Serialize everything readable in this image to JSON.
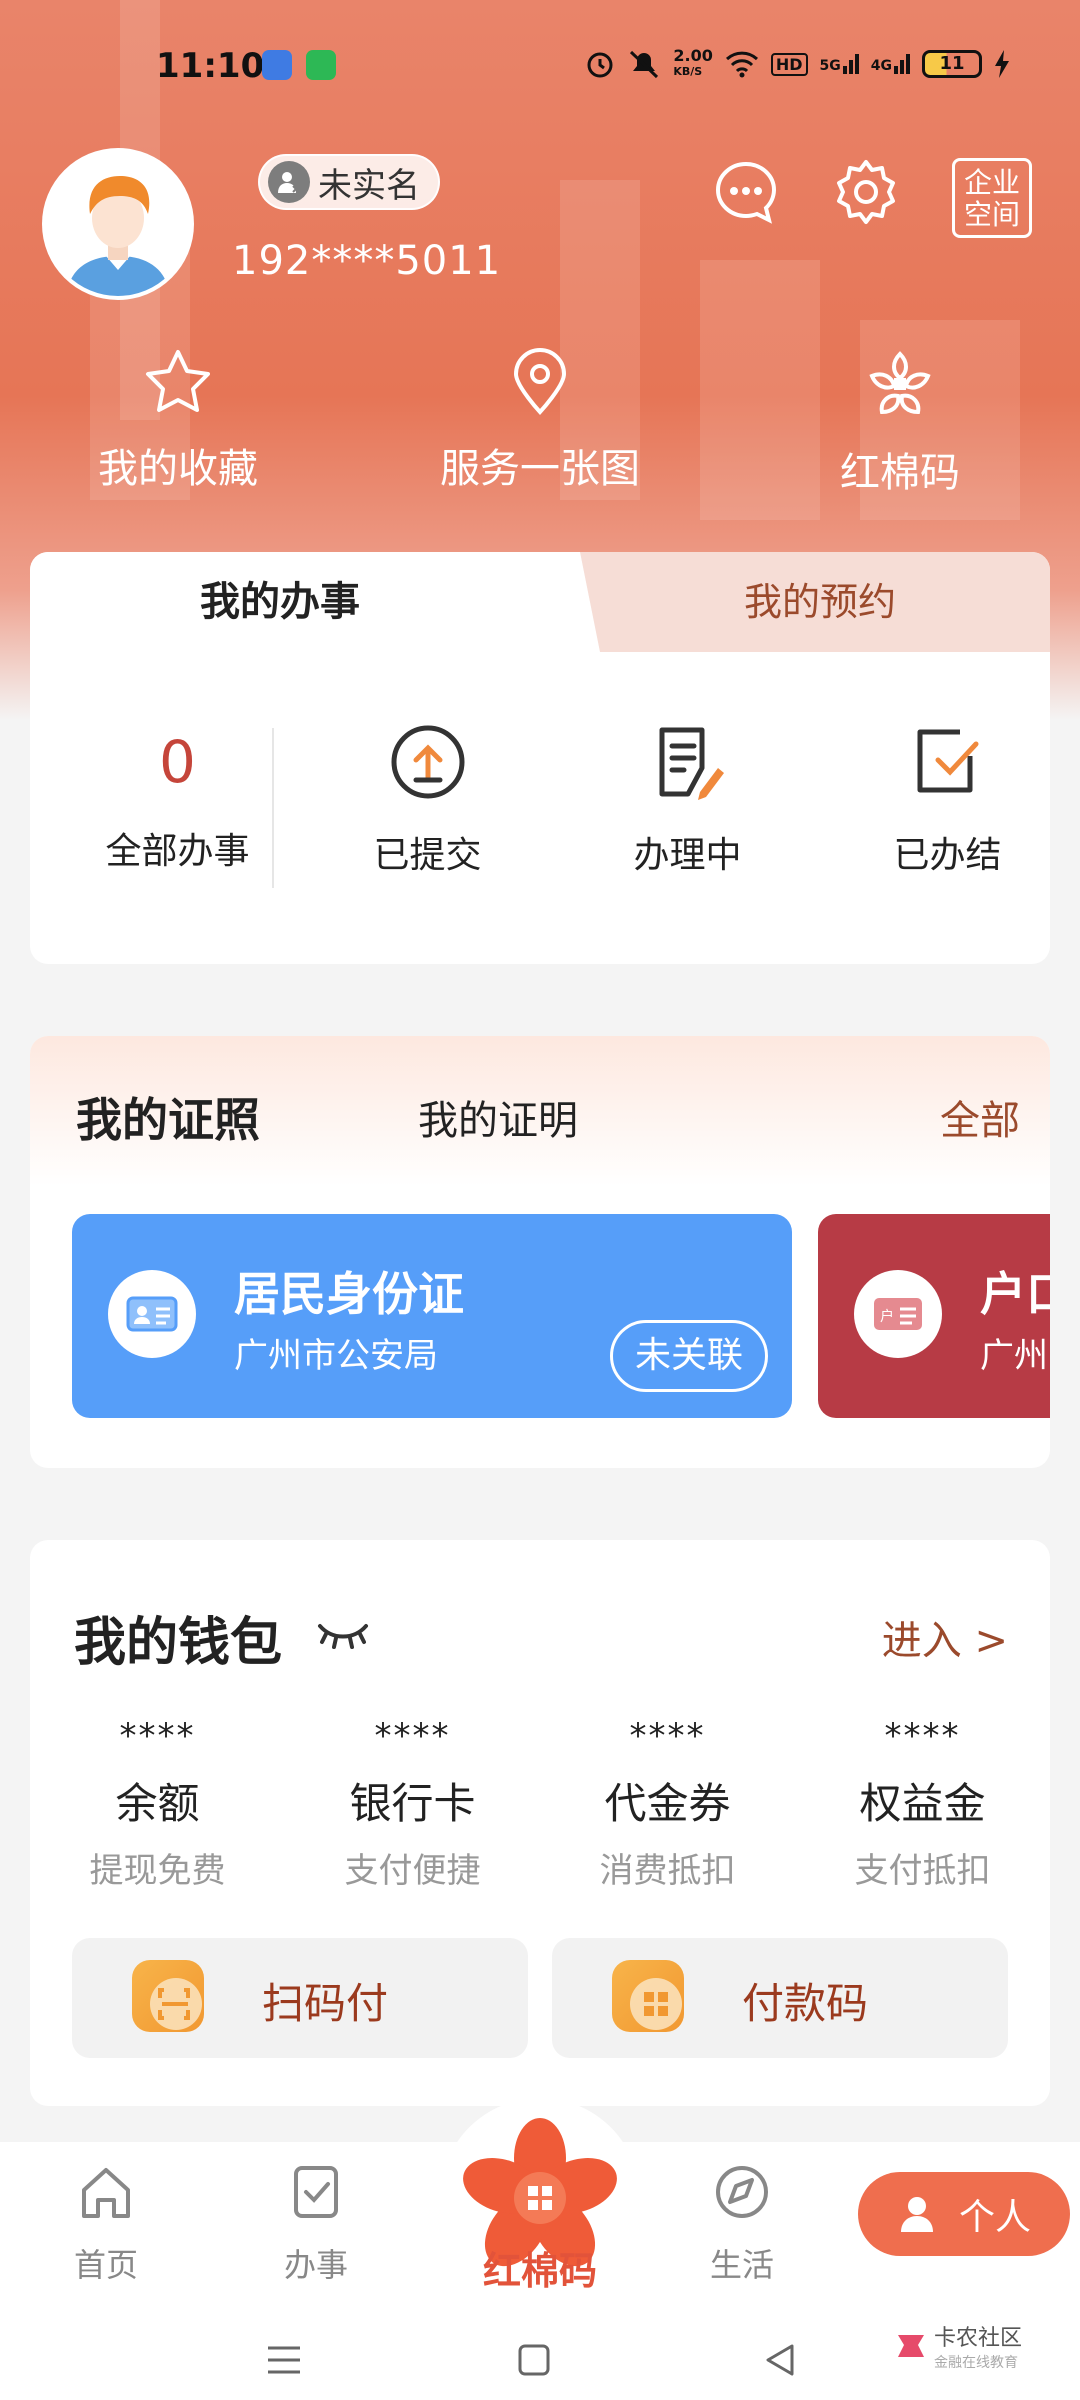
{
  "status_bar": {
    "time": "11:10",
    "net_speed_value": "2.00",
    "net_speed_unit": "KB/S",
    "signal1": "5G",
    "signal2": "4G",
    "battery": "11",
    "hd_label": "HD"
  },
  "profile": {
    "real_name_status": "未实名",
    "phone": "192****5011",
    "enterprise_label_line1": "企业",
    "enterprise_label_line2": "空间"
  },
  "quick_actions": [
    {
      "label": "我的收藏",
      "icon": "star-icon"
    },
    {
      "label": "服务一张图",
      "icon": "location-pin-icon"
    },
    {
      "label": "红棉码",
      "icon": "kapok-flower-icon"
    }
  ],
  "affairs": {
    "tab_active": "我的办事",
    "tab_inactive": "我的预约",
    "total_count": "0",
    "items": [
      {
        "label": "全部办事"
      },
      {
        "label": "已提交",
        "icon": "upload-circle-icon"
      },
      {
        "label": "办理中",
        "icon": "document-edit-icon"
      },
      {
        "label": "已办结",
        "icon": "checkbox-done-icon"
      }
    ]
  },
  "certificates": {
    "title": "我的证照",
    "tab2": "我的证明",
    "all_link": "全部",
    "cards": [
      {
        "name": "居民身份证",
        "org": "广州市公安局",
        "status": "未关联",
        "color": "#569ef9"
      },
      {
        "name": "户口",
        "org": "广州",
        "color": "#b73b45"
      }
    ],
    "second_card_icon_text": "户"
  },
  "wallet": {
    "title": "我的钱包",
    "enter_link": "进入 >",
    "items": [
      {
        "stars": "****",
        "name": "余额",
        "sub": "提现免费"
      },
      {
        "stars": "****",
        "name": "银行卡",
        "sub": "支付便捷"
      },
      {
        "stars": "****",
        "name": "代金券",
        "sub": "消费抵扣"
      },
      {
        "stars": "****",
        "name": "权益金",
        "sub": "支付抵扣"
      }
    ],
    "scan_pay": "扫码付",
    "pay_code": "付款码"
  },
  "bottom_nav": {
    "home": "首页",
    "affairs": "办事",
    "center": "红棉码",
    "life": "生活",
    "personal": "个人"
  },
  "watermark": {
    "line1": "卡农社区",
    "line2": "金融在线教育"
  },
  "colors": {
    "accent": "#e67556",
    "brand_red": "#e2533a",
    "link_brown": "#9b4a2c",
    "id_card_blue": "#569ef9",
    "hukou_red": "#b73b45"
  }
}
